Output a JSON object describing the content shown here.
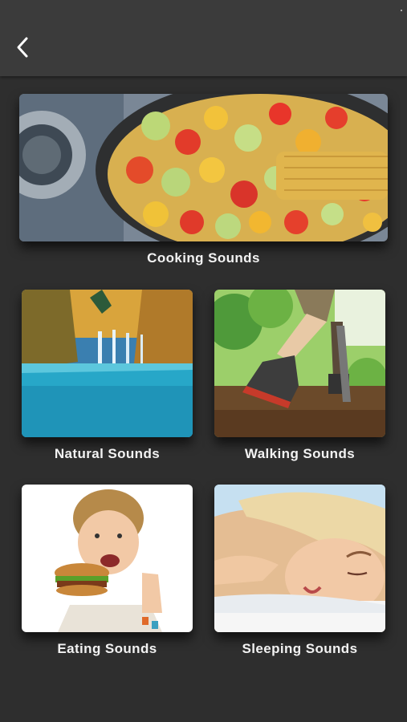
{
  "header": {
    "back_icon": "chevron-left-icon"
  },
  "categories": [
    {
      "label": "Cooking Sounds"
    },
    {
      "label": "Natural Sounds"
    },
    {
      "label": "Walking Sounds"
    },
    {
      "label": "Eating Sounds"
    },
    {
      "label": "Sleeping Sounds"
    }
  ],
  "colors": {
    "background": "#2e2e2e",
    "header": "#3b3b3b",
    "label": "#f2f2f2"
  }
}
